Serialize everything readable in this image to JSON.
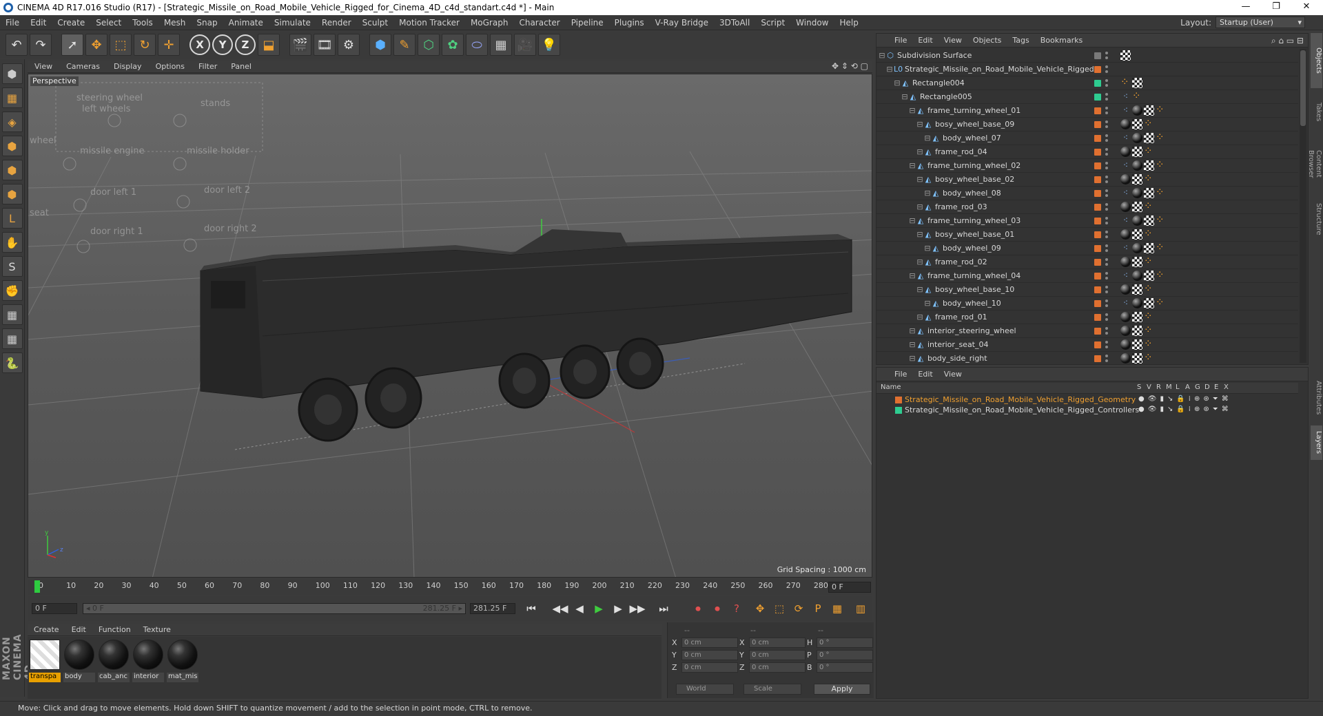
{
  "window": {
    "title": "CINEMA 4D R17.016 Studio (R17) - [Strategic_Missile_on_Road_Mobile_Vehicle_Rigged_for_Cinema_4D_c4d_standart.c4d *] - Main",
    "minimize": "—",
    "restore": "❐",
    "close": "✕"
  },
  "menu": [
    "File",
    "Edit",
    "Create",
    "Select",
    "Tools",
    "Mesh",
    "Snap",
    "Animate",
    "Simulate",
    "Render",
    "Sculpt",
    "Motion Tracker",
    "MoGraph",
    "Character",
    "Pipeline",
    "Plugins",
    "V-Ray Bridge",
    "3DToAll",
    "Script",
    "Window",
    "Help"
  ],
  "layout": {
    "label": "Layout:",
    "value": "Startup (User)"
  },
  "toolbar": {
    "undo": "↶",
    "redo": "↷",
    "live_select": "➚",
    "move": "✥",
    "scale": "⬚",
    "rotate": "↻",
    "transform": "✛",
    "axis_x": "X",
    "axis_y": "Y",
    "axis_z": "Z",
    "coord_system": "⬓",
    "render_view": "🎬",
    "render_pv": "🎞",
    "render_settings": "⚙",
    "cube": "⬢",
    "pen": "✎",
    "subdiv": "⬡",
    "cloner": "✿",
    "deformer": "⬭",
    "floor": "▦",
    "camera": "🎥",
    "light": "💡"
  },
  "lefttools": [
    "⬢",
    "▦",
    "◈",
    "⬢",
    "⬢",
    "⬢",
    "L",
    "✋",
    "S",
    "✊",
    "▦",
    "▦",
    "🐍"
  ],
  "maxon": "MAXON CINEMA 4D",
  "viewport": {
    "menu": [
      "View",
      "Cameras",
      "Display",
      "Options",
      "Filter",
      "Panel"
    ],
    "nav_icons": "✥ ⇕ ⟲ ▢",
    "label": "Perspective",
    "grid_spacing": "Grid Spacing : 1000 cm",
    "ghost_labels": [
      "steering wheel",
      "left wheels",
      "stands",
      "missile engine",
      "missile holder",
      "door left 1",
      "door left 2",
      "door right 1",
      "door right 2",
      "wheel",
      "seat"
    ]
  },
  "timeline": {
    "ticks": [
      "0",
      "10",
      "20",
      "30",
      "40",
      "50",
      "60",
      "70",
      "80",
      "90",
      "100",
      "110",
      "120",
      "130",
      "140",
      "150",
      "160",
      "170",
      "180",
      "190",
      "200",
      "210",
      "220",
      "230",
      "240",
      "250",
      "260",
      "270",
      "280"
    ],
    "current_frame": "0 F",
    "start_field": "0 F",
    "range_start": "◂ 0 F",
    "range_end": "281.25 F ▸",
    "end_field": "281.25 F"
  },
  "transport": {
    "go_start": "⏮",
    "prev_key": "◀◀",
    "prev_frame": "◀",
    "play": "▶",
    "next_frame": "▶",
    "next_key": "▶▶",
    "go_end": "⏭",
    "record": "⏺",
    "autokey": "⏺",
    "keysel": "?",
    "pos": "✥",
    "scl": "⬚",
    "rot": "⟳",
    "param": "P",
    "pla": "▦",
    "timeline_btn": "▥"
  },
  "materials": {
    "menu": [
      "Create",
      "Edit",
      "Function",
      "Texture"
    ],
    "items": [
      {
        "name": "transpa",
        "checker": true,
        "selected": true
      },
      {
        "name": "body",
        "checker": false,
        "selected": false
      },
      {
        "name": "cab_anc",
        "checker": false,
        "selected": false
      },
      {
        "name": "interior",
        "checker": false,
        "selected": false
      },
      {
        "name": "mat_mis",
        "checker": false,
        "selected": false
      }
    ]
  },
  "coords": {
    "heads": [
      "--",
      "--",
      "--"
    ],
    "rows": [
      {
        "l1": "X",
        "v1": "0 cm",
        "l2": "X",
        "v2": "0 cm",
        "l3": "H",
        "v3": "0 °"
      },
      {
        "l1": "Y",
        "v1": "0 cm",
        "l2": "Y",
        "v2": "0 cm",
        "l3": "P",
        "v3": "0 °"
      },
      {
        "l1": "Z",
        "v1": "0 cm",
        "l2": "Z",
        "v2": "0 cm",
        "l3": "B",
        "v3": "0 °"
      }
    ],
    "space": "World",
    "mode": "Scale",
    "apply": "Apply"
  },
  "status": "Move: Click and drag to move elements. Hold down SHIFT to quantize movement / add to the selection in point mode, CTRL to remove.",
  "object_manager": {
    "menu": [
      "File",
      "Edit",
      "View",
      "Objects",
      "Tags",
      "Bookmarks"
    ],
    "tool_icons": "⌕ ⌂ ▭ ⊟",
    "rows": [
      {
        "name": "Subdivision Surface",
        "depth": 0,
        "icon": "⬡",
        "color": "#7a7a7a",
        "tags": [
          "check"
        ]
      },
      {
        "name": "Strategic_Missile_on_Road_Mobile_Vehicle_Rigged",
        "depth": 1,
        "icon": "L0",
        "color": "#e07030",
        "tags": []
      },
      {
        "name": "Rectangle004",
        "depth": 2,
        "icon": "◭",
        "color": "#2ecc90",
        "tags": [
          "dots",
          "check"
        ]
      },
      {
        "name": "Rectangle005",
        "depth": 3,
        "icon": "◭",
        "color": "#2ecc90",
        "tags": [
          "rig",
          "dots"
        ]
      },
      {
        "name": "frame_turning_wheel_01",
        "depth": 4,
        "icon": "◭",
        "color": "#e07030",
        "tags": [
          "rig",
          "sphere",
          "check",
          "dots"
        ]
      },
      {
        "name": "bosy_wheel_base_09",
        "depth": 5,
        "icon": "◭",
        "color": "#e07030",
        "tags": [
          "sphere",
          "check",
          "dots"
        ]
      },
      {
        "name": "body_wheel_07",
        "depth": 6,
        "icon": "◭",
        "color": "#e07030",
        "tags": [
          "rig",
          "sphere",
          "check",
          "dots"
        ]
      },
      {
        "name": "frame_rod_04",
        "depth": 5,
        "icon": "◭",
        "color": "#e07030",
        "tags": [
          "sphere",
          "check",
          "dots"
        ]
      },
      {
        "name": "frame_turning_wheel_02",
        "depth": 4,
        "icon": "◭",
        "color": "#e07030",
        "tags": [
          "rig",
          "sphere",
          "check",
          "dots"
        ]
      },
      {
        "name": "bosy_wheel_base_02",
        "depth": 5,
        "icon": "◭",
        "color": "#e07030",
        "tags": [
          "sphere",
          "check",
          "dots"
        ]
      },
      {
        "name": "body_wheel_08",
        "depth": 6,
        "icon": "◭",
        "color": "#e07030",
        "tags": [
          "rig",
          "sphere",
          "check",
          "dots"
        ]
      },
      {
        "name": "frame_rod_03",
        "depth": 5,
        "icon": "◭",
        "color": "#e07030",
        "tags": [
          "sphere",
          "check",
          "dots"
        ]
      },
      {
        "name": "frame_turning_wheel_03",
        "depth": 4,
        "icon": "◭",
        "color": "#e07030",
        "tags": [
          "rig",
          "sphere",
          "check",
          "dots"
        ]
      },
      {
        "name": "bosy_wheel_base_01",
        "depth": 5,
        "icon": "◭",
        "color": "#e07030",
        "tags": [
          "sphere",
          "check",
          "dots"
        ]
      },
      {
        "name": "body_wheel_09",
        "depth": 6,
        "icon": "◭",
        "color": "#e07030",
        "tags": [
          "rig",
          "sphere",
          "check",
          "dots"
        ]
      },
      {
        "name": "frame_rod_02",
        "depth": 5,
        "icon": "◭",
        "color": "#e07030",
        "tags": [
          "sphere",
          "check",
          "dots"
        ]
      },
      {
        "name": "frame_turning_wheel_04",
        "depth": 4,
        "icon": "◭",
        "color": "#e07030",
        "tags": [
          "rig",
          "sphere",
          "check",
          "dots"
        ]
      },
      {
        "name": "bosy_wheel_base_10",
        "depth": 5,
        "icon": "◭",
        "color": "#e07030",
        "tags": [
          "sphere",
          "check",
          "dots"
        ]
      },
      {
        "name": "body_wheel_10",
        "depth": 6,
        "icon": "◭",
        "color": "#e07030",
        "tags": [
          "rig",
          "sphere",
          "check",
          "dots"
        ]
      },
      {
        "name": "frame_rod_01",
        "depth": 5,
        "icon": "◭",
        "color": "#e07030",
        "tags": [
          "sphere",
          "check",
          "dots"
        ]
      },
      {
        "name": "interior_steering_wheel",
        "depth": 4,
        "icon": "◭",
        "color": "#e07030",
        "tags": [
          "sphere",
          "check",
          "dots"
        ]
      },
      {
        "name": "interior_seat_04",
        "depth": 4,
        "icon": "◭",
        "color": "#e07030",
        "tags": [
          "sphere",
          "check",
          "dots"
        ]
      },
      {
        "name": "body_side_right",
        "depth": 4,
        "icon": "◭",
        "color": "#e07030",
        "tags": [
          "sphere",
          "check",
          "dots"
        ]
      }
    ]
  },
  "layer_manager": {
    "menu": [
      "File",
      "Edit",
      "View"
    ],
    "headers": [
      "Name",
      "S",
      "V",
      "R",
      "M",
      "L",
      "A",
      "G",
      "D",
      "E",
      "X"
    ],
    "icon_glyphs": [
      "●",
      "👁",
      "▮",
      "↘",
      "🔒",
      "⁞",
      "⊕",
      "⊛",
      "⏷",
      "⌘"
    ],
    "layers": [
      {
        "name": "Strategic_Missile_on_Road_Mobile_Vehicle_Rigged_Geometry",
        "color": "#e07030",
        "text_color": "#f0a030"
      },
      {
        "name": "Strategic_Missile_on_Road_Mobile_Vehicle_Rigged_Controllers",
        "color": "#2ecc90",
        "text_color": "#d8d8d8"
      }
    ]
  },
  "side_tabs": [
    "Objects",
    "Takes",
    "Content Browser",
    "Structure",
    "Attributes",
    "Layers"
  ]
}
